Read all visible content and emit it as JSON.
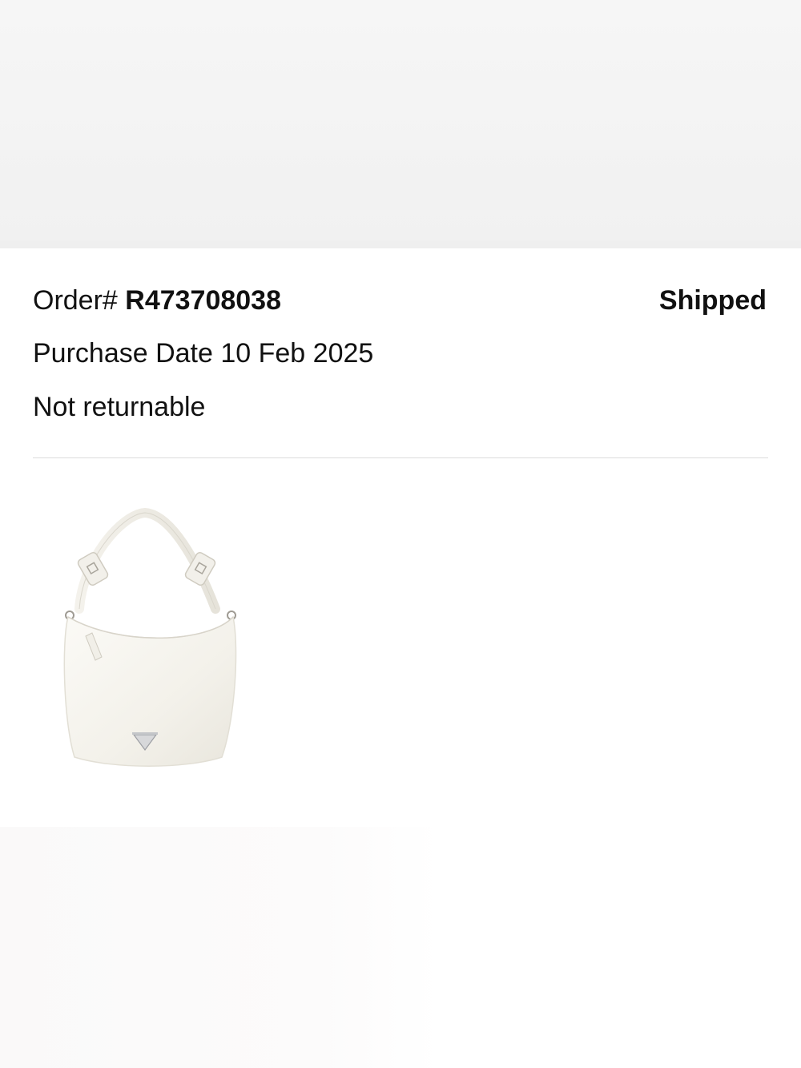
{
  "order": {
    "label": "Order#",
    "number": "R473708038",
    "status": "Shipped",
    "purchase_label": "Purchase Date",
    "purchase_date": "10 Feb 2025",
    "return_policy": "Not returnable"
  },
  "product": {
    "icon": "white-shoulder-bag-image"
  },
  "colors": {
    "text": "#111111",
    "divider": "#dcdcdc",
    "background": "#ffffff",
    "band": "#f3f3f3"
  }
}
